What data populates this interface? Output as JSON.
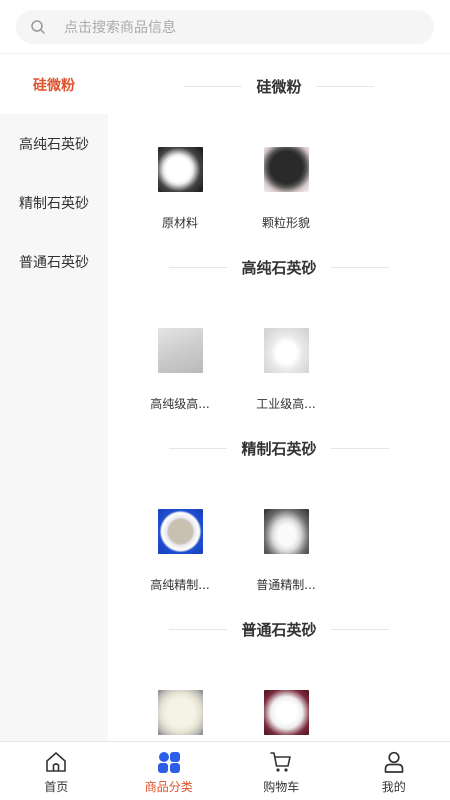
{
  "search": {
    "placeholder": "点击搜索商品信息"
  },
  "sidebar": {
    "items": [
      {
        "label": "硅微粉",
        "active": true
      },
      {
        "label": "高纯石英砂",
        "active": false
      },
      {
        "label": "精制石英砂",
        "active": false
      },
      {
        "label": "普通石英砂",
        "active": false
      }
    ]
  },
  "sections": [
    {
      "title": "硅微粉",
      "products": [
        {
          "name": "原材料"
        },
        {
          "name": "颗粒形貌"
        }
      ]
    },
    {
      "title": "高纯石英砂",
      "products": [
        {
          "name": "高纯级高..."
        },
        {
          "name": "工业级高..."
        }
      ]
    },
    {
      "title": "精制石英砂",
      "products": [
        {
          "name": "高纯精制..."
        },
        {
          "name": "普通精制..."
        }
      ]
    },
    {
      "title": "普通石英砂",
      "products": [
        {
          "name": ""
        },
        {
          "name": ""
        }
      ]
    }
  ],
  "tabbar": {
    "items": [
      {
        "label": "首页",
        "icon": "home-icon"
      },
      {
        "label": "商品分类",
        "icon": "category-icon",
        "active": true
      },
      {
        "label": "购物车",
        "icon": "cart-icon"
      },
      {
        "label": "我的",
        "icon": "user-icon"
      }
    ]
  },
  "colors": {
    "accent": "#e0522c",
    "category_icon": "#2b5fe6",
    "sidebar_bg": "#f7f7f7"
  }
}
